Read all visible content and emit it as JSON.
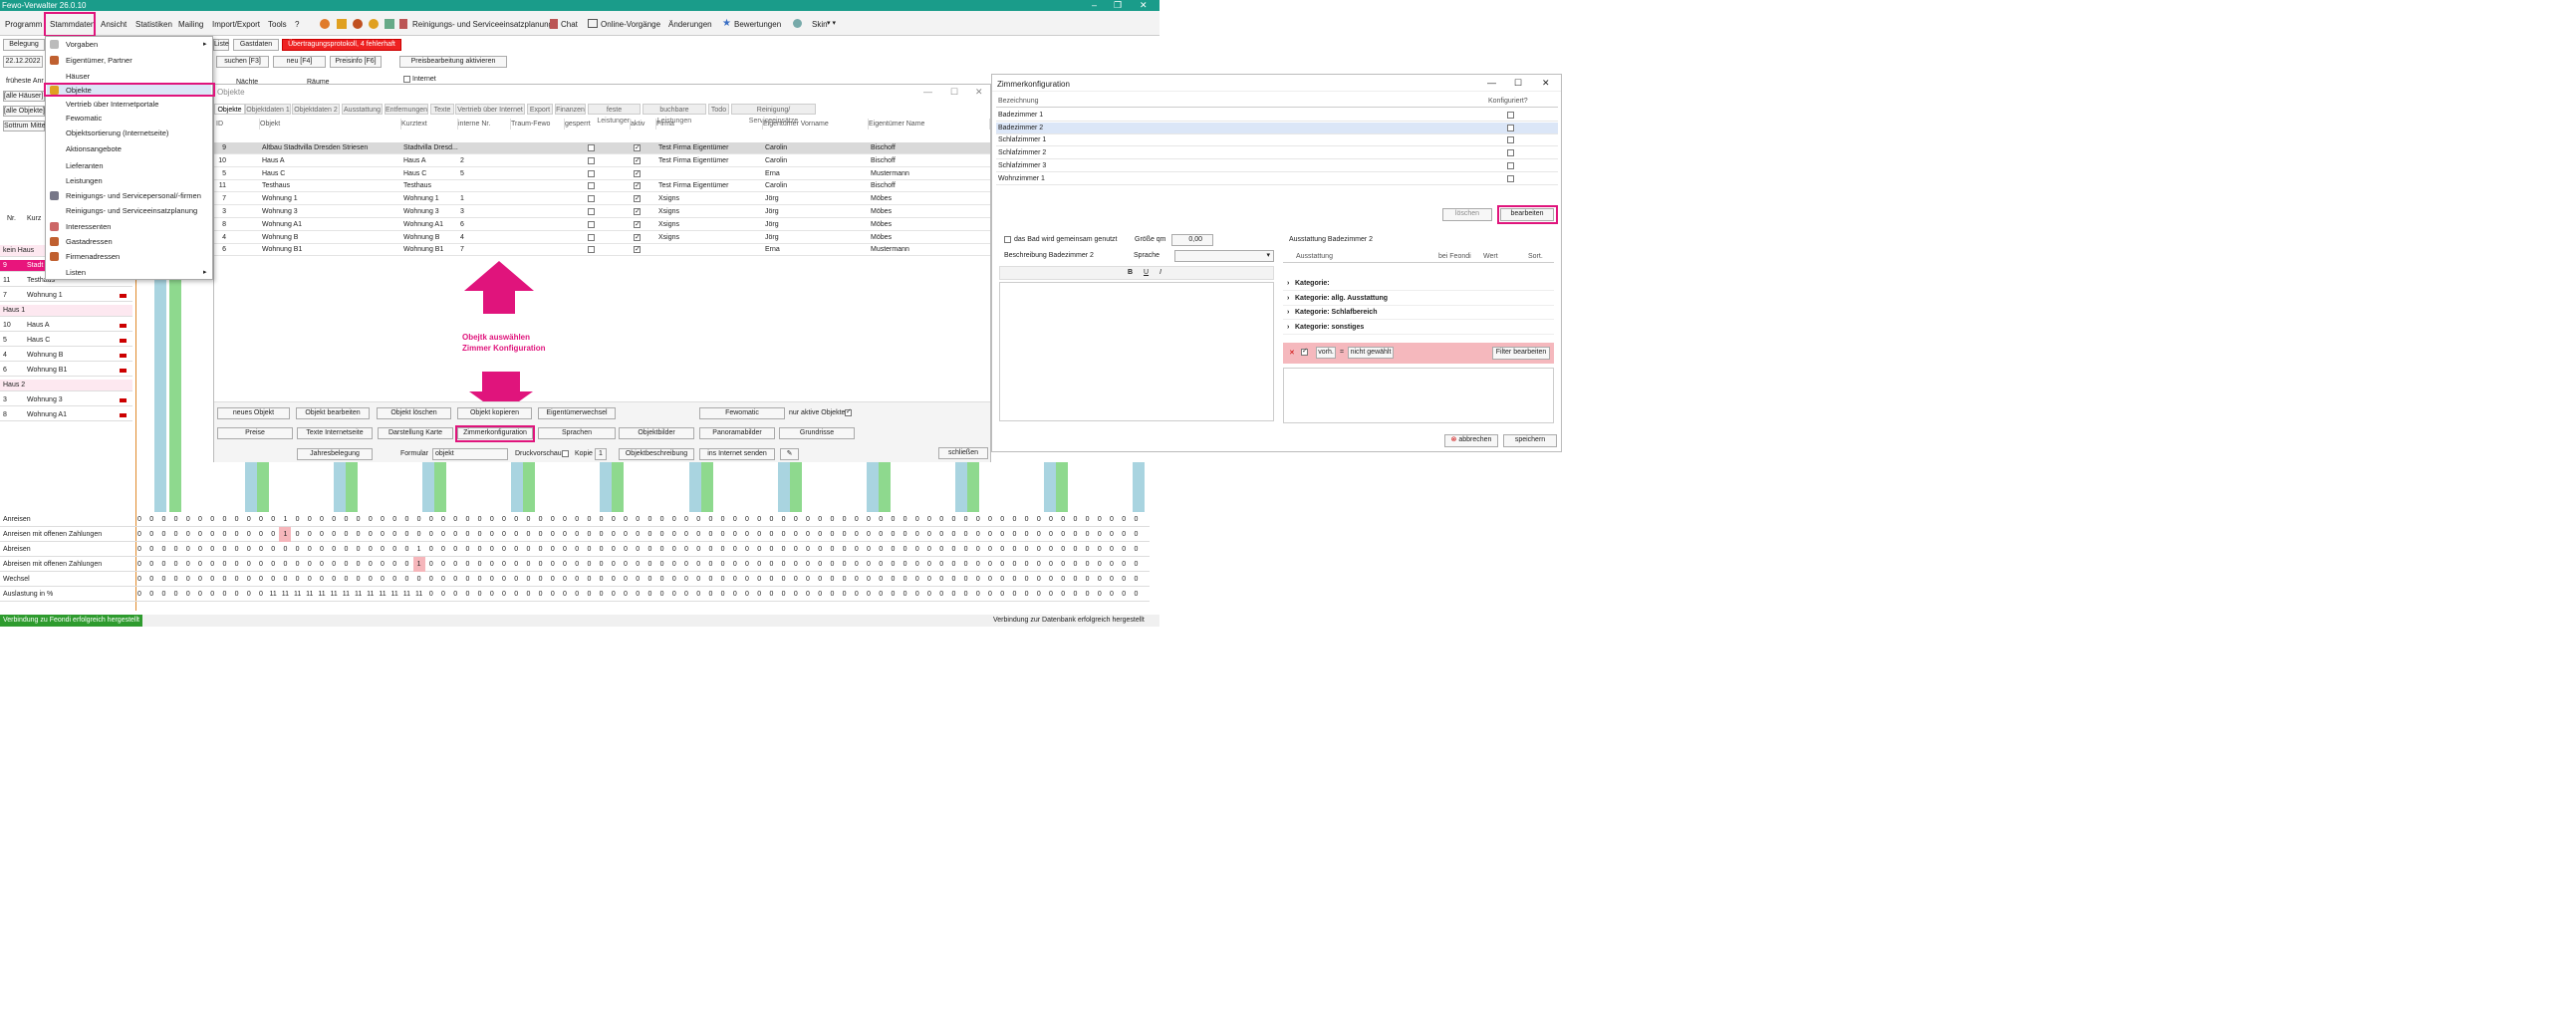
{
  "app": {
    "title": "Fewo-Verwalter 26.0.10",
    "accent_color": "#e0147c",
    "titlebar_color": "#1a9c8a"
  },
  "menubar": {
    "items": [
      "Programm",
      "Stammdaten",
      "Ansicht",
      "Statistiken",
      "Mailing",
      "Import/Export",
      "Tools",
      "?"
    ],
    "toolbar_items": [
      "Reinigungs- und Serviceeinsatzplanung",
      "Chat",
      "Online-Vorgänge",
      "Änderungen",
      "Bewertungen",
      "Skin"
    ]
  },
  "toolrow": {
    "belegung": "Belegung",
    "liste": "Liste",
    "gastdaten": "Gastdaten",
    "alert": "Übertragungsprotokoll, 4 fehlerhaft",
    "date": "22.12.2022",
    "search": "suchen [F3]",
    "new": "neu [F4]",
    "priceinfo": "Preisinfo [F6]",
    "pricebatch": "Preisbearbeitung aktivieren",
    "earliest": "früheste Anr",
    "filter1": "[alle Häuser]",
    "filter2": "[alle Objekte]",
    "filter3": "Sottrum Mitte",
    "naechte": "Nächte",
    "raeume": "Räume",
    "internet": "Internet"
  },
  "dropdown": {
    "items": [
      {
        "label": "Vorgaben",
        "submenu": true
      },
      {
        "label": "Eigentümer, Partner"
      },
      {
        "label": "Häuser"
      },
      {
        "label": "Objekte",
        "active": true
      },
      {
        "label": "Vertrieb über Internetportale"
      },
      {
        "label": "Fewomatic"
      },
      {
        "label": "Objektsortierung (Internetseite)"
      },
      {
        "label": "Aktionsangebote"
      },
      {
        "label": "Lieferanten"
      },
      {
        "label": "Leistungen"
      },
      {
        "label": "Reinigungs- und Servicepersonal/-firmen"
      },
      {
        "label": "Reinigungs- und Serviceeinsatzplanung"
      },
      {
        "label": "Interessenten"
      },
      {
        "label": "Gastadressen"
      },
      {
        "label": "Firmenadressen"
      },
      {
        "label": "Listen",
        "submenu": true
      }
    ]
  },
  "leftlist": {
    "header_nr": "Nr.",
    "header_kurz": "Kurz",
    "rows": [
      {
        "nr": "kein Haus",
        "name": "",
        "group": true
      },
      {
        "nr": "9",
        "name": "Stadt",
        "hl": true
      },
      {
        "nr": "11",
        "name": "Testhaus",
        "flag": false
      },
      {
        "nr": "7",
        "name": "Wohnung 1",
        "flag": true
      },
      {
        "nr": "Haus 1",
        "name": "",
        "group": true
      },
      {
        "nr": "10",
        "name": "Haus A",
        "flag": true
      },
      {
        "nr": "5",
        "name": "Haus C",
        "flag": true
      },
      {
        "nr": "4",
        "name": "Wohnung B",
        "flag": true
      },
      {
        "nr": "6",
        "name": "Wohnung B1",
        "flag": true
      },
      {
        "nr": "Haus 2",
        "name": "",
        "group": true
      },
      {
        "nr": "3",
        "name": "Wohnung 3",
        "flag": true
      },
      {
        "nr": "8",
        "name": "Wohnung A1",
        "flag": true
      }
    ]
  },
  "objwin": {
    "title": "Objekte",
    "tabs": [
      "Objekte",
      "Objektdaten 1",
      "Objektdaten 2",
      "Ausstattung",
      "Entfernungen",
      "Texte",
      "Vertrieb über Internet",
      "Export",
      "Finanzen",
      "feste Leistungen",
      "buchbare Leistungen",
      "Todo",
      "Reinigung/ Serviceeinsätze"
    ],
    "columns": [
      "ID",
      "Objekt",
      "Kurztext",
      "interne Nr.",
      "Traum-Fewo",
      "gesperrt",
      "aktiv",
      "Firma",
      "Eigentümer Vorname",
      "Eigentümer Name"
    ],
    "rows": [
      {
        "id": "9",
        "objekt": "Altbau Stadtvilla Dresden Striesen",
        "kurz": "Stadtvilla Dresd...",
        "intern": "",
        "gesperrt": false,
        "aktiv": true,
        "firma": "Test Firma Eigentümer",
        "vorname": "Carolin",
        "name": "Bischoff",
        "sel": true
      },
      {
        "id": "10",
        "objekt": "Haus A",
        "kurz": "Haus A",
        "intern": "2",
        "gesperrt": false,
        "aktiv": true,
        "firma": "Test Firma Eigentümer",
        "vorname": "Carolin",
        "name": "Bischoff"
      },
      {
        "id": "5",
        "objekt": "Haus C",
        "kurz": "Haus C",
        "intern": "5",
        "gesperrt": false,
        "aktiv": true,
        "firma": "",
        "vorname": "Erna",
        "name": "Mustermann"
      },
      {
        "id": "11",
        "objekt": "Testhaus",
        "kurz": "Testhaus",
        "intern": "",
        "gesperrt": false,
        "aktiv": true,
        "firma": "Test Firma Eigentümer",
        "vorname": "Carolin",
        "name": "Bischoff"
      },
      {
        "id": "7",
        "objekt": "Wohnung 1",
        "kurz": "Wohnung 1",
        "intern": "1",
        "gesperrt": false,
        "aktiv": true,
        "firma": "Xsigns",
        "vorname": "Jörg",
        "name": "Möbes"
      },
      {
        "id": "3",
        "objekt": "Wohnung 3",
        "kurz": "Wohnung 3",
        "intern": "3",
        "gesperrt": false,
        "aktiv": true,
        "firma": "Xsigns",
        "vorname": "Jörg",
        "name": "Möbes"
      },
      {
        "id": "8",
        "objekt": "Wohnung A1",
        "kurz": "Wohnung A1",
        "intern": "6",
        "gesperrt": false,
        "aktiv": true,
        "firma": "Xsigns",
        "vorname": "Jörg",
        "name": "Möbes"
      },
      {
        "id": "4",
        "objekt": "Wohnung B",
        "kurz": "Wohnung B",
        "intern": "4",
        "gesperrt": false,
        "aktiv": true,
        "firma": "Xsigns",
        "vorname": "Jörg",
        "name": "Möbes"
      },
      {
        "id": "6",
        "objekt": "Wohnung B1",
        "kurz": "Wohnung B1",
        "intern": "7",
        "gesperrt": false,
        "aktiv": true,
        "firma": "",
        "vorname": "Erna",
        "name": "Mustermann"
      }
    ],
    "annotation_line1": "Obejtk auswählen",
    "annotation_line2": "Zimmer Konfiguration",
    "buttons": {
      "neu": "neues Objekt",
      "bearbeiten": "Objekt bearbeiten",
      "loeschen": "Objekt löschen",
      "kopieren": "Objekt kopieren",
      "eigentuemerwechsel": "Eigentümerwechsel",
      "fewomatic": "Fewomatic",
      "nur_aktive": "nur aktive Objekte",
      "preise": "Preise",
      "texte": "Texte Internetseite",
      "karte": "Darstellung Karte",
      "zimmer": "Zimmerkonfiguration",
      "sprachen": "Sprachen",
      "bilder": "Objektbilder",
      "panorama": "Panoramabilder",
      "grundrisse": "Grundrisse",
      "jahres": "Jahresbelegung",
      "formular": "Formular",
      "formular_val": "objekt",
      "druckvorschau": "Druckvorschau",
      "kopie": "Kopie",
      "kopie_val": "1",
      "beschreibung": "Objektbeschreibung",
      "internet": "ins Internet senden",
      "schliessen": "schließen"
    }
  },
  "cfgwin": {
    "title": "Zimmerkonfiguration",
    "col_bez": "Bezeichnung",
    "col_konf": "Konfiguriert?",
    "rooms": [
      "Badezimmer 1",
      "Badezimmer 2",
      "Schlafzimmer 1",
      "Schlafzimmer 2",
      "Schlafzimmer 3",
      "Wohnzimmer 1"
    ],
    "selected_room": 1,
    "loeschen": "löschen",
    "bearbeiten": "bearbeiten",
    "gemeinsam": "das Bad wird gemeinsam genutzt",
    "groesse": "Größe qm",
    "groesse_val": "0,00",
    "beschreibung": "Beschreibung Badezimmer 2",
    "sprache": "Sprache",
    "ausstattung_title": "Ausstattung Badezimmer 2",
    "aus_cols": [
      "Ausstattung",
      "bei Feondi",
      "Wert",
      "Sort."
    ],
    "categories": [
      "Kategorie:",
      "Kategorie: allg. Ausstattung",
      "Kategorie: Schlafbereich",
      "Kategorie: sonstiges"
    ],
    "filter_vorh": "vorh.",
    "filter_eq": "=",
    "filter_val": "nicht gewählt",
    "filter_btn": "Filter bearbeiten",
    "abbrechen": "abbrechen",
    "speichern": "speichern"
  },
  "stats": {
    "rows": [
      {
        "label": "Anreisen",
        "values": [
          0,
          0,
          0,
          0,
          0,
          0,
          0,
          0,
          0,
          0,
          0,
          0,
          1,
          0,
          0,
          0,
          0,
          0,
          0,
          0,
          0,
          0,
          0,
          0,
          0,
          0,
          0,
          0,
          0,
          0,
          0,
          0,
          0,
          0,
          0,
          0,
          0,
          0,
          0,
          0,
          0,
          0,
          0,
          0,
          0,
          0,
          0,
          0,
          0,
          0,
          0,
          0,
          0,
          0,
          0,
          0,
          0,
          0,
          0,
          0,
          0,
          0,
          0,
          0,
          0,
          0,
          0,
          0,
          0,
          0,
          0,
          0,
          0,
          0,
          0,
          0,
          0,
          0,
          0,
          0,
          0,
          0,
          0,
          0,
          0
        ]
      },
      {
        "label": "Anreisen mit offenen Zahlungen",
        "values": [
          0,
          0,
          0,
          0,
          0,
          0,
          0,
          0,
          0,
          0,
          0,
          0,
          1,
          0,
          0,
          0,
          0,
          0,
          0,
          0,
          0,
          0,
          0,
          0,
          0,
          0,
          0,
          0,
          0,
          0,
          0,
          0,
          0,
          0,
          0,
          0,
          0,
          0,
          0,
          0,
          0,
          0,
          0,
          0,
          0,
          0,
          0,
          0,
          0,
          0,
          0,
          0,
          0,
          0,
          0,
          0,
          0,
          0,
          0,
          0,
          0,
          0,
          0,
          0,
          0,
          0,
          0,
          0,
          0,
          0,
          0,
          0,
          0,
          0,
          0,
          0,
          0,
          0,
          0,
          0,
          0,
          0,
          0,
          0,
          0
        ],
        "hl": 12
      },
      {
        "label": "Abreisen",
        "values": [
          0,
          0,
          0,
          0,
          0,
          0,
          0,
          0,
          0,
          0,
          0,
          0,
          0,
          0,
          0,
          0,
          0,
          0,
          0,
          0,
          0,
          0,
          0,
          1,
          0,
          0,
          0,
          0,
          0,
          0,
          0,
          0,
          0,
          0,
          0,
          0,
          0,
          0,
          0,
          0,
          0,
          0,
          0,
          0,
          0,
          0,
          0,
          0,
          0,
          0,
          0,
          0,
          0,
          0,
          0,
          0,
          0,
          0,
          0,
          0,
          0,
          0,
          0,
          0,
          0,
          0,
          0,
          0,
          0,
          0,
          0,
          0,
          0,
          0,
          0,
          0,
          0,
          0,
          0,
          0,
          0,
          0,
          0,
          0,
          0
        ]
      },
      {
        "label": "Abreisen mit offenen Zahlungen",
        "values": [
          0,
          0,
          0,
          0,
          0,
          0,
          0,
          0,
          0,
          0,
          0,
          0,
          0,
          0,
          0,
          0,
          0,
          0,
          0,
          0,
          0,
          0,
          0,
          1,
          0,
          0,
          0,
          0,
          0,
          0,
          0,
          0,
          0,
          0,
          0,
          0,
          0,
          0,
          0,
          0,
          0,
          0,
          0,
          0,
          0,
          0,
          0,
          0,
          0,
          0,
          0,
          0,
          0,
          0,
          0,
          0,
          0,
          0,
          0,
          0,
          0,
          0,
          0,
          0,
          0,
          0,
          0,
          0,
          0,
          0,
          0,
          0,
          0,
          0,
          0,
          0,
          0,
          0,
          0,
          0,
          0,
          0,
          0,
          0,
          0
        ],
        "hl": 23
      },
      {
        "label": "Wechsel",
        "values": [
          0,
          0,
          0,
          0,
          0,
          0,
          0,
          0,
          0,
          0,
          0,
          0,
          0,
          0,
          0,
          0,
          0,
          0,
          0,
          0,
          0,
          0,
          0,
          0,
          0,
          0,
          0,
          0,
          0,
          0,
          0,
          0,
          0,
          0,
          0,
          0,
          0,
          0,
          0,
          0,
          0,
          0,
          0,
          0,
          0,
          0,
          0,
          0,
          0,
          0,
          0,
          0,
          0,
          0,
          0,
          0,
          0,
          0,
          0,
          0,
          0,
          0,
          0,
          0,
          0,
          0,
          0,
          0,
          0,
          0,
          0,
          0,
          0,
          0,
          0,
          0,
          0,
          0,
          0,
          0,
          0,
          0,
          0,
          0,
          0
        ]
      },
      {
        "label": "Auslastung in %",
        "values": [
          0,
          0,
          0,
          0,
          0,
          0,
          0,
          0,
          0,
          0,
          0,
          11,
          11,
          11,
          11,
          11,
          11,
          11,
          11,
          11,
          11,
          11,
          11,
          11,
          0,
          0,
          0,
          0,
          0,
          0,
          0,
          0,
          0,
          0,
          0,
          0,
          0,
          0,
          0,
          0,
          0,
          0,
          0,
          0,
          0,
          0,
          0,
          0,
          0,
          0,
          0,
          0,
          0,
          0,
          0,
          0,
          0,
          0,
          0,
          0,
          0,
          0,
          0,
          0,
          0,
          0,
          0,
          0,
          0,
          0,
          0,
          0,
          0,
          0,
          0,
          0,
          0,
          0,
          0,
          0,
          0,
          0,
          0,
          0,
          0
        ]
      }
    ]
  },
  "statusbar": {
    "left": "Verbindung zu Feondi erfolgreich hergestellt",
    "right": "Verbindung zur Datenbank erfolgreich hergestellt"
  }
}
